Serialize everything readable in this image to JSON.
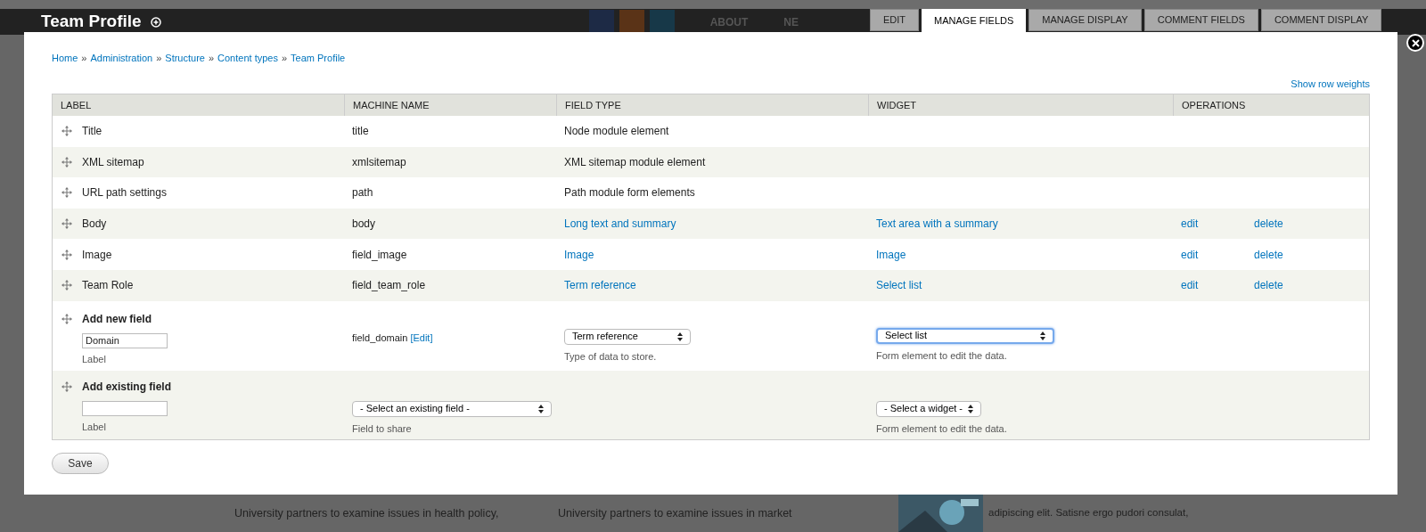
{
  "background": {
    "site_title": "Team Profile",
    "nav": [
      "ABOUT",
      "NE"
    ],
    "texts": [
      "University partners to examine issues in health policy,",
      "University partners to examine issues in market",
      "adipiscing elit. Satisne ergo pudori consulat,"
    ]
  },
  "tabs": [
    {
      "label": "EDIT",
      "selected": false
    },
    {
      "label": "MANAGE FIELDS",
      "selected": true
    },
    {
      "label": "MANAGE DISPLAY",
      "selected": false
    },
    {
      "label": "COMMENT FIELDS",
      "selected": false
    },
    {
      "label": "COMMENT DISPLAY",
      "selected": false
    }
  ],
  "breadcrumb": [
    "Home",
    "Administration",
    "Structure",
    "Content types",
    "Team Profile"
  ],
  "breadcrumb_separator": "»",
  "show_row_weights": "Show row weights",
  "table": {
    "columns": [
      "LABEL",
      "MACHINE NAME",
      "FIELD TYPE",
      "WIDGET",
      "OPERATIONS"
    ],
    "rows": [
      {
        "label": "Title",
        "machine_name": "title",
        "field_type": "Node module element",
        "linked": false
      },
      {
        "label": "XML sitemap",
        "machine_name": "xmlsitemap",
        "field_type": "XML sitemap module element",
        "linked": false
      },
      {
        "label": "URL path settings",
        "machine_name": "path",
        "field_type": "Path module form elements",
        "linked": false
      },
      {
        "label": "Body",
        "machine_name": "body",
        "field_type": "Long text and summary",
        "widget": "Text area with a summary",
        "operations": [
          "edit",
          "delete"
        ],
        "linked": true
      },
      {
        "label": "Image",
        "machine_name": "field_image",
        "field_type": "Image",
        "widget": "Image",
        "operations": [
          "edit",
          "delete"
        ],
        "linked": true
      },
      {
        "label": "Team Role",
        "machine_name": "field_team_role",
        "field_type": "Term reference",
        "widget": "Select list",
        "operations": [
          "edit",
          "delete"
        ],
        "linked": true
      }
    ],
    "add_new": {
      "title": "Add new field",
      "label_value": "Domain",
      "label_hint": "Label",
      "machine_name": "field_domain",
      "machine_edit": "[Edit]",
      "type_select": "Term reference",
      "type_hint": "Type of data to store.",
      "widget_select": "Select list",
      "widget_focused": true,
      "widget_hint": "Form element to edit the data."
    },
    "add_existing": {
      "title": "Add existing field",
      "label_hint": "Label",
      "field_select": "- Select an existing field -",
      "field_hint": "Field to share",
      "widget_select": "- Select a widget -",
      "widget_focused": false,
      "widget_hint": "Form element to edit the data."
    }
  },
  "save": "Save"
}
